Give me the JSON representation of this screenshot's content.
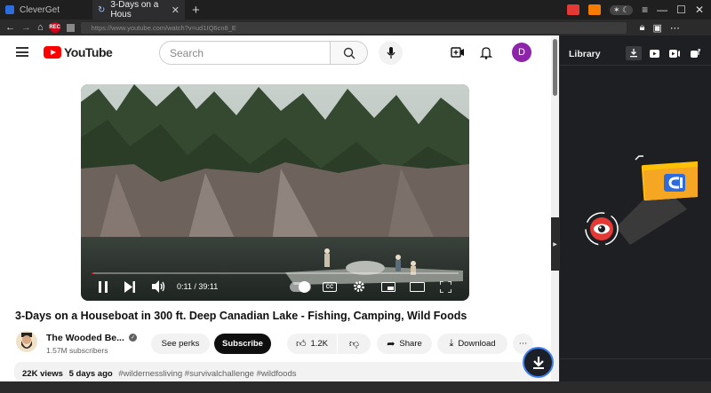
{
  "browser": {
    "app_tab_label": "CleverGet",
    "active_tab_label": "3-Days on a Hous",
    "url": "https://www.youtube.com/watch?v=ud1IQ6cn8_E",
    "rec_badge": "REC"
  },
  "youtube": {
    "logo_text": "YouTube",
    "search_placeholder": "Search",
    "avatar_letter": "D",
    "player": {
      "current_time": "0:11",
      "duration": "39:11",
      "time_separator": " / ",
      "progress": 0.005
    },
    "video_title": "3-Days on a Houseboat in 300 ft. Deep Canadian Lake - Fishing, Camping, Wild Foods",
    "channel_name": "The Wooded Be...",
    "subscribers": "1.57M subscribers",
    "see_perks_label": "See perks",
    "subscribe_label": "Subscribe",
    "like_count": "1.2K",
    "share_label": "Share",
    "download_label": "Download",
    "views": "22K views",
    "uploaded": "5 days ago",
    "hashtags": "#wildernessliving #survivalchallenge #wildfoods"
  },
  "library": {
    "title": "Library",
    "accent_color": "#ffc107",
    "brand_blue": "#2d6cdf"
  }
}
